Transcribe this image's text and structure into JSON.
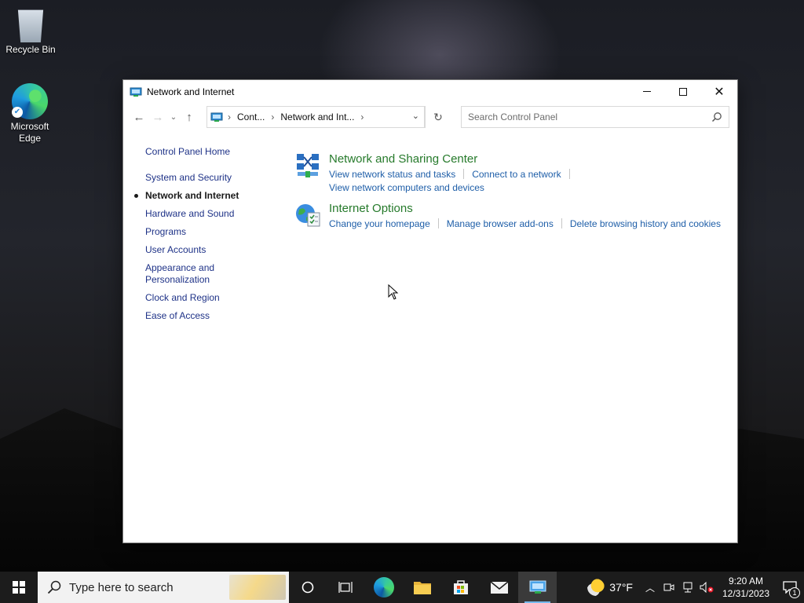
{
  "desktop": {
    "icons": [
      {
        "label": "Recycle Bin"
      },
      {
        "label": "Microsoft Edge"
      }
    ]
  },
  "window": {
    "title": "Network and Internet",
    "breadcrumb": [
      "Cont...",
      "Network and Int..."
    ],
    "search_placeholder": "Search Control Panel",
    "left_nav": {
      "home": "Control Panel Home",
      "items": [
        {
          "label": "System and Security",
          "current": false
        },
        {
          "label": "Network and Internet",
          "current": true
        },
        {
          "label": "Hardware and Sound",
          "current": false
        },
        {
          "label": "Programs",
          "current": false
        },
        {
          "label": "User Accounts",
          "current": false
        },
        {
          "label": "Appearance and Personalization",
          "current": false
        },
        {
          "label": "Clock and Region",
          "current": false
        },
        {
          "label": "Ease of Access",
          "current": false
        }
      ]
    },
    "sections": [
      {
        "heading": "Network and Sharing Center",
        "icon": "network-sharing-icon",
        "links": [
          "View network status and tasks",
          "Connect to a network",
          "View network computers and devices"
        ]
      },
      {
        "heading": "Internet Options",
        "icon": "internet-options-icon",
        "links": [
          "Change your homepage",
          "Manage browser add-ons",
          "Delete browsing history and cookies"
        ]
      }
    ]
  },
  "taskbar": {
    "search_placeholder": "Type here to search",
    "weather": "37°F",
    "time": "9:20 AM",
    "date": "12/31/2023",
    "notification_count": "1"
  },
  "colors": {
    "link": "#1e5ea8",
    "heading_green": "#267a2b",
    "nav_link": "#1e3287",
    "taskbar": "#1c1c1c"
  }
}
